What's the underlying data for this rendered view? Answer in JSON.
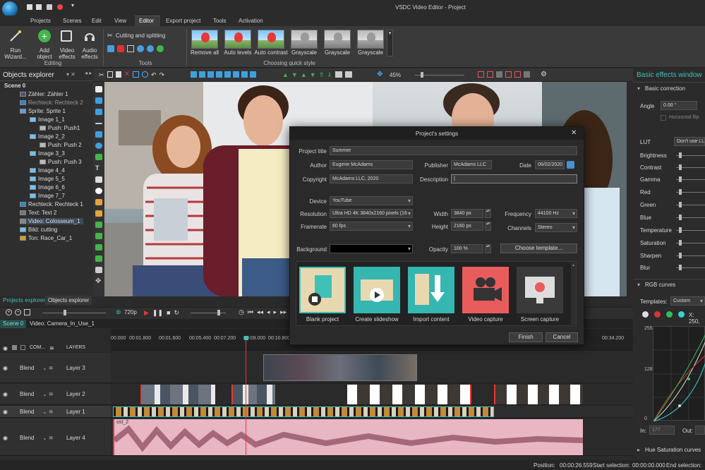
{
  "window": {
    "title": "VSDC Video Editor - Project"
  },
  "menu": [
    "Projects",
    "Scenes",
    "Edit",
    "View",
    "Editor",
    "Export project",
    "Tools",
    "Activation"
  ],
  "ribbon": {
    "run_wizard": "Run Wizard...",
    "add_object": "Add object",
    "video_effects": "Video effects",
    "audio_effects": "Audio effects",
    "group_editing": "Editing",
    "cutting": "Cutting and splitting",
    "group_tools": "Tools",
    "quick_styles": [
      "Remove all",
      "Auto levels",
      "Auto contrast",
      "Grayscale",
      "Grayscale",
      "Grayscale"
    ],
    "group_quick_style": "Choosing quick style"
  },
  "objects_explorer": {
    "title": "Objects explorer",
    "items": [
      "Scene 0",
      "Zähler: Zähler 1",
      "Rechteck: Rechteck 2",
      "Sprite: Sprite 1",
      "Image 1_1",
      "Push: Push1",
      "Image 2_2",
      "Push: Push 2",
      "Image 3_3",
      "Push: Push 3",
      "Image 4_4",
      "Image 5_5",
      "Image 6_6",
      "Image 7_7",
      "Rechteck: Rechteck 1",
      "Text: Text 2",
      "Video: Colosseum_1",
      "Bild: cutting",
      "Ton: Race_Car_1"
    ],
    "tabs": [
      "Projects explorer",
      "Objects explorer"
    ]
  },
  "editor_toolbar": {
    "zoom": "45%"
  },
  "playbar": {
    "quality": "720p"
  },
  "scene_tabs": [
    "Scene 0",
    "Video: Camera_In_Use_1"
  ],
  "timeline": {
    "header_com": "COM...",
    "header_layers": "LAYERS",
    "ruler": [
      "00.000",
      "00:01.800",
      "00:01.600",
      "00:05.400",
      "00:07.200",
      "00:09.000",
      "00:10.800",
      "00:34.200"
    ],
    "tracks": [
      {
        "blend": "Blend",
        "layer": "Layer 3"
      },
      {
        "blend": "Blend",
        "layer": "Layer 2"
      },
      {
        "blend": "Blend",
        "layer": "Layer 1"
      },
      {
        "blend": "Blend",
        "layer": "Layer 4"
      }
    ],
    "audio_clip_label": "ost_2"
  },
  "right_panel": {
    "title": "Basic effects window",
    "basic_correction": "Basic correction",
    "angle_label": "Angle",
    "angle_value": "0.00 °",
    "hflip": "Horizontal flip",
    "lut_label": "LUT",
    "lut_value": "Don't use LUT",
    "params": [
      "Brightness",
      "Contrast",
      "Gamma",
      "Red",
      "Green",
      "Blue",
      "Temperature",
      "Saturation",
      "Sharpen",
      "Blur"
    ],
    "rgb_curves": "RGB curves",
    "templates_label": "Templates:",
    "templates_value": "Custom",
    "x_readout": "X: 250,",
    "curve_ticks": [
      "255",
      "128",
      "0"
    ],
    "in_label": "In:",
    "in_value": "177",
    "out_label": "Out:",
    "out_value": "",
    "hue_sat": "Hue Saturation curves"
  },
  "status": {
    "position_label": "Position:",
    "position_value": "00:00:26.559",
    "start_label": "Start selection:",
    "start_value": "00:00:00.000",
    "end_label": "End selection:"
  },
  "dialog": {
    "title": "Project's settings",
    "project_title_label": "Project title",
    "project_title": "Summer",
    "author_label": "Author",
    "author": "Eugene McAdams",
    "publisher_label": "Publisher",
    "publisher": "McAdams LLC",
    "date_label": "Date",
    "date": "06/02/2020",
    "copyright_label": "Copyright",
    "copyright": "McAdams LLC, 2020",
    "description_label": "Description",
    "description": "|",
    "device_label": "Device",
    "device": "YouTube",
    "resolution_label": "Resolution",
    "resolution": "Ultra HD 4K 3840x2160 pixels (16",
    "framerate_label": "Framerate",
    "framerate": "60 fps",
    "width_label": "Width",
    "width": "3840 px",
    "height_label": "Height",
    "height": "2160 px",
    "frequency_label": "Frequency",
    "frequency": "44100 Hz",
    "channels_label": "Channels",
    "channels": "Stereo",
    "background_label": "Background",
    "opacity_label": "Opacity",
    "opacity": "100 %",
    "choose_template": "Choose template...",
    "tiles": [
      "Blank project",
      "Create slideshow",
      "Import content",
      "Video capture",
      "Screen capture"
    ],
    "finish": "Finish",
    "cancel": "Cancel"
  },
  "colors": {
    "accent": "#2aa7a0",
    "tile_1": "#e8d8b0",
    "tile_2": "#35b6b0",
    "tile_3": "#35b6b0",
    "tile_4": "#e85c5c",
    "tile_5": "#3a3a3a"
  }
}
